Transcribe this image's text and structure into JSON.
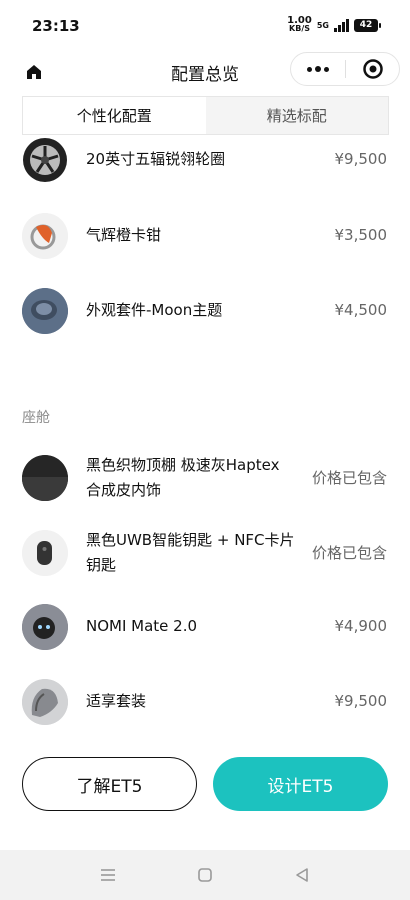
{
  "status_bar": {
    "time": "23:13",
    "net_speed_value": "1.00",
    "net_speed_unit": "KB/S",
    "net_type": "5G",
    "battery": "42"
  },
  "nav": {
    "title": "配置总览"
  },
  "tabs": [
    {
      "label": "个性化配置",
      "active": true
    },
    {
      "label": "精选标配",
      "active": false
    }
  ],
  "items_exterior": [
    {
      "name": "20英寸五辐锐翎轮圈",
      "price": "¥9,500",
      "icon": "wheel-icon"
    },
    {
      "name": "气辉橙卡钳",
      "price": "¥3,500",
      "icon": "caliper-icon"
    },
    {
      "name": "外观套件-Moon主题",
      "price": "¥4,500",
      "icon": "moon-kit-icon"
    }
  ],
  "section_cabin": "座舱",
  "items_cabin": [
    {
      "name_line1": "黑色织物顶棚 极速灰Haptex",
      "name_line2": "合成皮内饰",
      "price": "价格已包含",
      "icon": "headliner-icon"
    },
    {
      "name_line1": "黑色UWB智能钥匙 + NFC卡片",
      "name_line2": "钥匙",
      "price": "价格已包含",
      "icon": "key-icon"
    },
    {
      "name": "NOMI Mate 2.0",
      "price": "¥4,900",
      "icon": "nomi-icon"
    },
    {
      "name": "适享套装",
      "price": "¥9,500",
      "icon": "seat-icon"
    }
  ],
  "buttons": {
    "learn": "了解ET5",
    "design": "设计ET5"
  },
  "colors": {
    "accent": "#1cc2bf"
  }
}
